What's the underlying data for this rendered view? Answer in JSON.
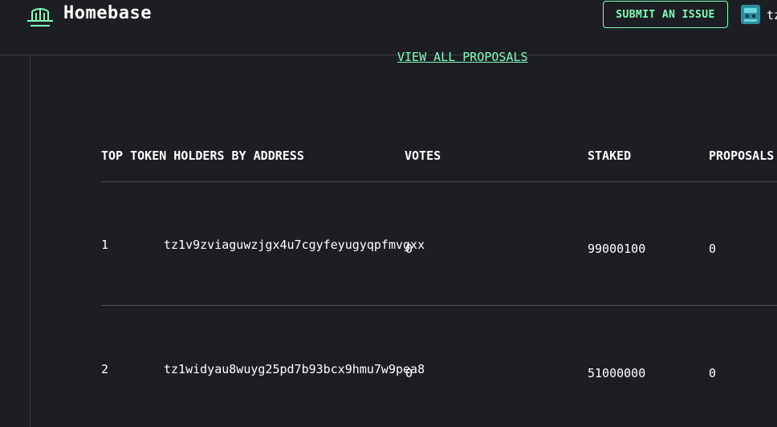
{
  "header": {
    "brand": "Homebase",
    "submit_issue_label": "SUBMIT AN ISSUE",
    "account_text": "tz",
    "accent_color": "#81feb7"
  },
  "main": {
    "view_all_link": "VIEW ALL PROPOSALS",
    "table": {
      "columns": [
        "TOP TOKEN HOLDERS BY ADDRESS",
        "VOTES",
        "STAKED",
        "PROPOSALS"
      ],
      "rows": [
        {
          "rank": "1",
          "address": "tz1v9zviaguwzjgx4u7cgyfeyugyqpfmvgxx",
          "votes": "0",
          "staked": "99000100",
          "proposals": "0"
        },
        {
          "rank": "2",
          "address": "tz1widyau8wuyg25pd7b93bcx9hmu7w9pea8",
          "votes": "0",
          "staked": "51000000",
          "proposals": "0"
        }
      ]
    }
  },
  "icons": {
    "logo": "homebase-logo-icon",
    "avatar": "account-avatar-icon"
  }
}
